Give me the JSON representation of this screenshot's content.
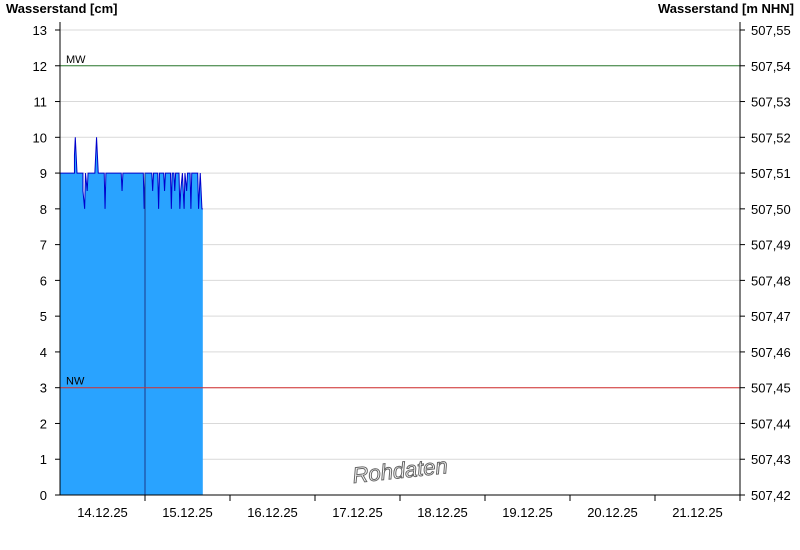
{
  "chart_data": {
    "type": "area",
    "ylabel_left": "Wasserstand [cm]",
    "ylabel_right": "Wasserstand [m NHN]",
    "ylim": [
      0,
      13
    ],
    "yticks": [
      0,
      1,
      2,
      3,
      4,
      5,
      6,
      7,
      8,
      9,
      10,
      11,
      12,
      13
    ],
    "right_ylim": [
      507.42,
      507.55
    ],
    "right_yticks": [
      "507,42",
      "507,43",
      "507,44",
      "507,45",
      "507,46",
      "507,47",
      "507,48",
      "507,49",
      "507,50",
      "507,51",
      "507,52",
      "507,53",
      "507,54",
      "507,55"
    ],
    "xlim": [
      0,
      8
    ],
    "x_unit": "days from 13.12.25 12:00",
    "date_labels": [
      "14.12.25",
      "15.12.25",
      "16.12.25",
      "17.12.25",
      "18.12.25",
      "19.12.25",
      "20.12.25",
      "21.12.25"
    ],
    "grid": true,
    "reference_lines": [
      {
        "label": "MW",
        "value": 12,
        "color": "#2e7d32"
      },
      {
        "label": "NW",
        "value": 3,
        "color": "#d32f2f"
      }
    ],
    "series": [
      {
        "fill_color": "#29a3ff",
        "line_color": "#0000cc",
        "points": [
          [
            0.0,
            9
          ],
          [
            0.17,
            9
          ],
          [
            0.17,
            9.5
          ],
          [
            0.18,
            10
          ],
          [
            0.19,
            9.5
          ],
          [
            0.2,
            9
          ],
          [
            0.27,
            9
          ],
          [
            0.27,
            8.5
          ],
          [
            0.29,
            8
          ],
          [
            0.3,
            9
          ],
          [
            0.32,
            8.5
          ],
          [
            0.33,
            9
          ],
          [
            0.41,
            9
          ],
          [
            0.42,
            9.5
          ],
          [
            0.43,
            10
          ],
          [
            0.44,
            9.5
          ],
          [
            0.45,
            9
          ],
          [
            0.52,
            9
          ],
          [
            0.53,
            8
          ],
          [
            0.54,
            9
          ],
          [
            0.72,
            9
          ],
          [
            0.73,
            8.5
          ],
          [
            0.74,
            9
          ],
          [
            0.98,
            9
          ],
          [
            0.99,
            8
          ],
          [
            1.0,
            9
          ],
          [
            1.08,
            9
          ],
          [
            1.09,
            8.5
          ],
          [
            1.1,
            9
          ],
          [
            1.15,
            9
          ],
          [
            1.16,
            8
          ],
          [
            1.17,
            9
          ],
          [
            1.22,
            9
          ],
          [
            1.23,
            8.5
          ],
          [
            1.24,
            9
          ],
          [
            1.3,
            9
          ],
          [
            1.31,
            8
          ],
          [
            1.32,
            9
          ],
          [
            1.34,
            9
          ],
          [
            1.35,
            8.5
          ],
          [
            1.36,
            9
          ],
          [
            1.4,
            9
          ],
          [
            1.41,
            8
          ],
          [
            1.42,
            8.5
          ],
          [
            1.44,
            9
          ],
          [
            1.46,
            8
          ],
          [
            1.47,
            9
          ],
          [
            1.49,
            8.5
          ],
          [
            1.5,
            9
          ],
          [
            1.53,
            9
          ],
          [
            1.54,
            8
          ],
          [
            1.55,
            9
          ],
          [
            1.62,
            9
          ],
          [
            1.63,
            8
          ],
          [
            1.64,
            8.5
          ],
          [
            1.65,
            9
          ],
          [
            1.66,
            8.5
          ],
          [
            1.67,
            8
          ],
          [
            1.68,
            8
          ]
        ]
      }
    ],
    "annotations": [
      "Rohdaten"
    ]
  }
}
